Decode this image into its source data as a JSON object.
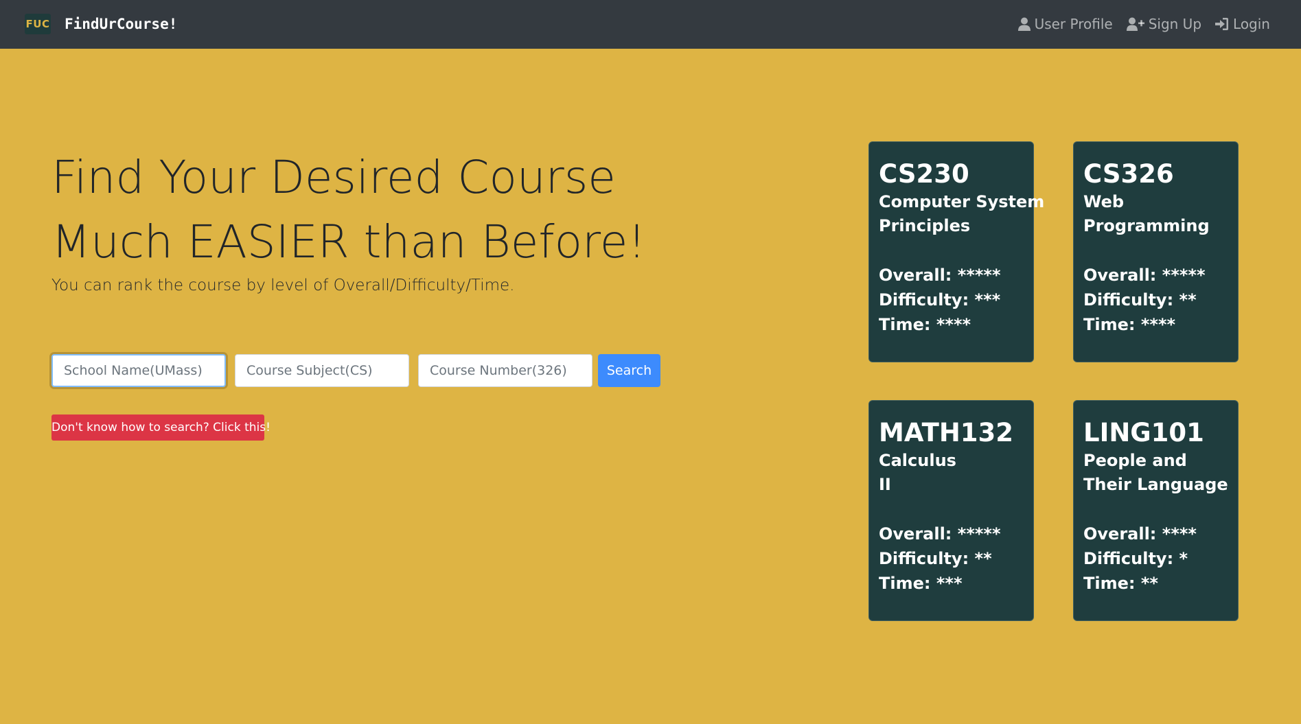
{
  "navbar": {
    "logo_text": "FUC",
    "brand": "FindUrCourse!",
    "links": [
      {
        "label": "User Profile",
        "icon": "user-icon"
      },
      {
        "label": "Sign Up",
        "icon": "user-plus-icon"
      },
      {
        "label": "Login",
        "icon": "sign-in-icon"
      }
    ]
  },
  "hero": {
    "title_line1": "Find Your Desired Course",
    "title_line2": "Much EASIER than Before!",
    "subtitle": "You can rank the course by level of Overall/Difficulty/Time."
  },
  "search": {
    "school_placeholder": "School Name(UMass)",
    "subject_placeholder": "Course Subject(CS)",
    "number_placeholder": "Course Number(326)",
    "button_label": "Search",
    "help_label": "Don't know how to search? Click this!"
  },
  "cards": [
    {
      "code": "CS230",
      "name_line1": "Computer System",
      "name_line2": "Principles",
      "overall": "Overall: *****",
      "difficulty": "Difficulty: ***",
      "time": "Time: ****"
    },
    {
      "code": "CS326",
      "name_line1": "Web",
      "name_line2": "Programming",
      "overall": "Overall: *****",
      "difficulty": "Difficulty: **",
      "time": "Time: ****"
    },
    {
      "code": "MATH132",
      "name_line1": "Calculus",
      "name_line2": "II",
      "overall": "Overall: *****",
      "difficulty": "Difficulty: **",
      "time": "Time: ***"
    },
    {
      "code": "LING101",
      "name_line1": "People and",
      "name_line2": "Their Language",
      "overall": "Overall: ****",
      "difficulty": "Difficulty: *",
      "time": "Time: **"
    }
  ],
  "colors": {
    "background": "#deb444",
    "navbar": "#343a40",
    "card": "#1f3d3e",
    "search_button": "#3d8bfd",
    "help_button": "#dc3545"
  }
}
